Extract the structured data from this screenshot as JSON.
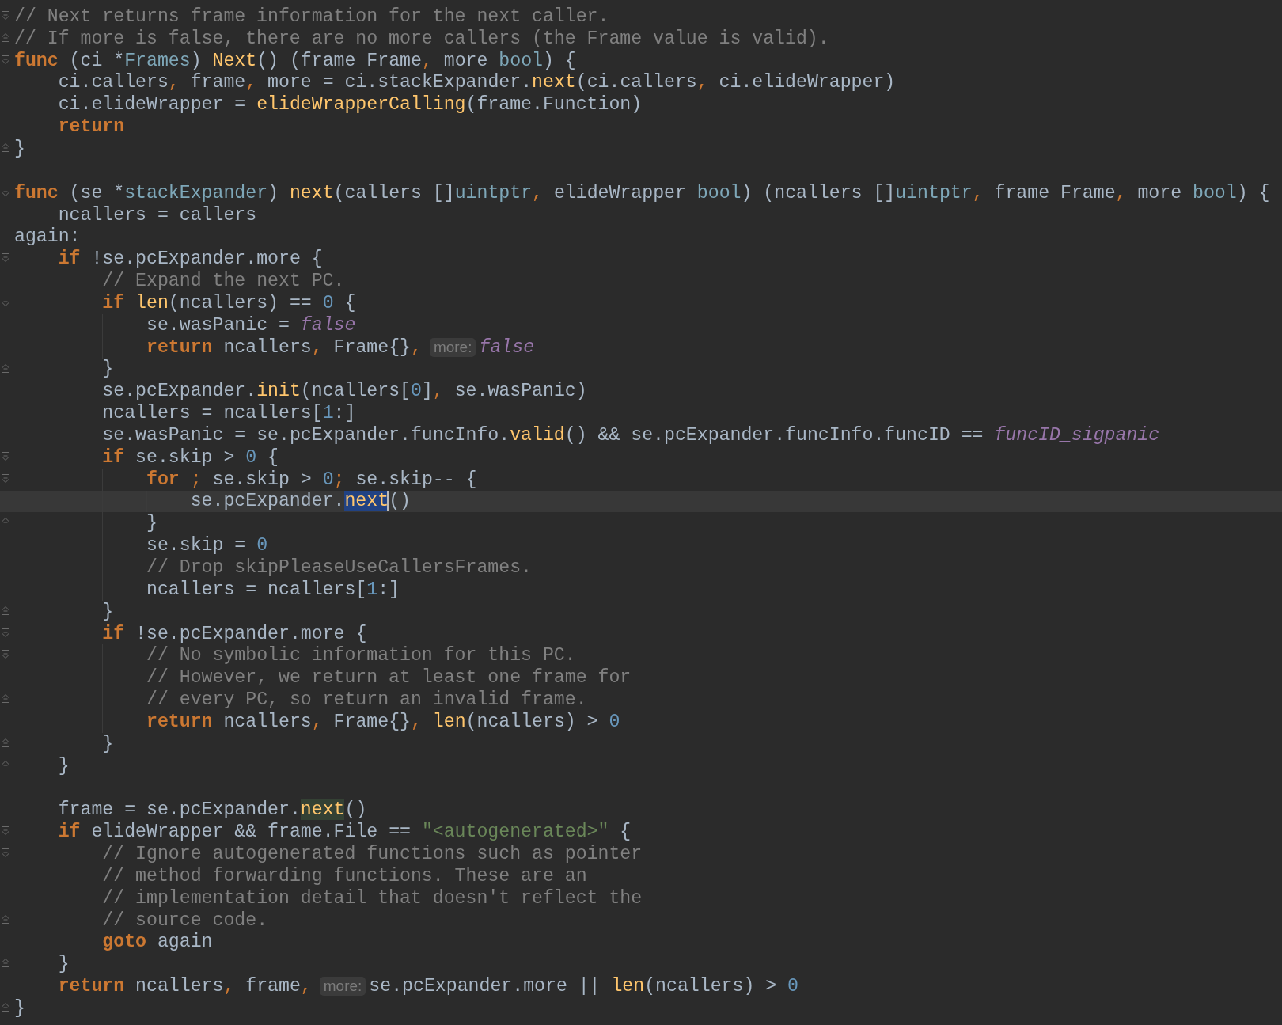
{
  "editor": {
    "lines": [
      {
        "fold_start": true,
        "fold_end": false,
        "current": false,
        "tokens": [
          {
            "text": "// Next returns frame information for the next caller.",
            "kind": "comment"
          }
        ]
      },
      {
        "fold_start": false,
        "fold_end": true,
        "current": false,
        "tokens": [
          {
            "text": "// If more is false, there are no more callers (the Frame value is valid).",
            "kind": "comment"
          }
        ]
      },
      {
        "fold_start": true,
        "fold_end": false,
        "current": false,
        "tokens": [
          {
            "text": "func",
            "kind": "keyword"
          },
          {
            "text": " (ci *",
            "kind": "plain"
          },
          {
            "text": "Frames",
            "kind": "type"
          },
          {
            "text": ") ",
            "kind": "plain"
          },
          {
            "text": "Next",
            "kind": "function"
          },
          {
            "text": "() (frame Frame",
            "kind": "plain"
          },
          {
            "text": ",",
            "kind": "punct"
          },
          {
            "text": " more ",
            "kind": "plain"
          },
          {
            "text": "bool",
            "kind": "type"
          },
          {
            "text": ") {",
            "kind": "plain"
          }
        ]
      },
      {
        "fold_start": false,
        "fold_end": false,
        "current": false,
        "tokens": [
          {
            "text": "    ci.callers",
            "kind": "plain"
          },
          {
            "text": ",",
            "kind": "punct"
          },
          {
            "text": " frame",
            "kind": "plain"
          },
          {
            "text": ",",
            "kind": "punct"
          },
          {
            "text": " more = ci.stackExpander.",
            "kind": "plain"
          },
          {
            "text": "next",
            "kind": "function"
          },
          {
            "text": "(ci.callers",
            "kind": "plain"
          },
          {
            "text": ",",
            "kind": "punct"
          },
          {
            "text": " ci.elideWrapper)",
            "kind": "plain"
          }
        ]
      },
      {
        "fold_start": false,
        "fold_end": false,
        "current": false,
        "tokens": [
          {
            "text": "    ci.elideWrapper = ",
            "kind": "plain"
          },
          {
            "text": "elideWrapperCalling",
            "kind": "function"
          },
          {
            "text": "(frame.Function)",
            "kind": "plain"
          }
        ]
      },
      {
        "fold_start": false,
        "fold_end": false,
        "current": false,
        "tokens": [
          {
            "text": "    return",
            "kind": "keyword"
          }
        ]
      },
      {
        "fold_start": false,
        "fold_end": true,
        "current": false,
        "tokens": [
          {
            "text": "}",
            "kind": "plain"
          }
        ]
      },
      {
        "fold_start": false,
        "fold_end": false,
        "current": false
      },
      {
        "fold_start": true,
        "fold_end": false,
        "current": false,
        "tokens": [
          {
            "text": "func",
            "kind": "keyword"
          },
          {
            "text": " (se *",
            "kind": "plain"
          },
          {
            "text": "stackExpander",
            "kind": "type"
          },
          {
            "text": ") ",
            "kind": "plain"
          },
          {
            "text": "next",
            "kind": "function"
          },
          {
            "text": "(callers []",
            "kind": "plain"
          },
          {
            "text": "uintptr",
            "kind": "type"
          },
          {
            "text": ",",
            "kind": "punct"
          },
          {
            "text": " elideWrapper ",
            "kind": "plain"
          },
          {
            "text": "bool",
            "kind": "type"
          },
          {
            "text": ") (ncallers []",
            "kind": "plain"
          },
          {
            "text": "uintptr",
            "kind": "type"
          },
          {
            "text": ",",
            "kind": "punct"
          },
          {
            "text": " frame Frame",
            "kind": "plain"
          },
          {
            "text": ",",
            "kind": "punct"
          },
          {
            "text": " more ",
            "kind": "plain"
          },
          {
            "text": "bool",
            "kind": "type"
          },
          {
            "text": ") {",
            "kind": "plain"
          }
        ]
      },
      {
        "fold_start": false,
        "fold_end": false,
        "current": false,
        "tokens": [
          {
            "text": "    ncallers = callers",
            "kind": "plain"
          }
        ]
      },
      {
        "fold_start": false,
        "fold_end": false,
        "current": false,
        "tokens": [
          {
            "text": "again:",
            "kind": "plain"
          }
        ]
      },
      {
        "fold_start": true,
        "fold_end": false,
        "current": false,
        "tokens": [
          {
            "text": "    if",
            "kind": "keyword"
          },
          {
            "text": " !se.pcExpander.more {",
            "kind": "plain"
          }
        ]
      },
      {
        "fold_start": false,
        "fold_end": false,
        "current": false,
        "tokens": [
          {
            "text": "        // Expand the next PC.",
            "kind": "comment"
          }
        ]
      },
      {
        "fold_start": true,
        "fold_end": false,
        "current": false,
        "tokens": [
          {
            "text": "        if ",
            "kind": "keyword"
          },
          {
            "text": "len",
            "kind": "function"
          },
          {
            "text": "(ncallers) == ",
            "kind": "plain"
          },
          {
            "text": "0",
            "kind": "number"
          },
          {
            "text": " {",
            "kind": "plain"
          }
        ]
      },
      {
        "fold_start": false,
        "fold_end": false,
        "current": false,
        "tokens": [
          {
            "text": "            se.wasPanic = ",
            "kind": "plain"
          },
          {
            "text": "false",
            "kind": "constant"
          }
        ]
      },
      {
        "fold_start": false,
        "fold_end": false,
        "current": false,
        "tokens": [
          {
            "text": "            return",
            "kind": "keyword"
          },
          {
            "text": " ncallers",
            "kind": "plain"
          },
          {
            "text": ",",
            "kind": "punct"
          },
          {
            "text": " Frame{}",
            "kind": "plain"
          },
          {
            "text": ",",
            "kind": "punct"
          },
          {
            "text": "more:",
            "kind": "hint"
          },
          {
            "text": "false",
            "kind": "constant"
          }
        ]
      },
      {
        "fold_start": false,
        "fold_end": true,
        "current": false,
        "tokens": [
          {
            "text": "        }",
            "kind": "plain"
          }
        ]
      },
      {
        "fold_start": false,
        "fold_end": false,
        "current": false,
        "tokens": [
          {
            "text": "        se.pcExpander.",
            "kind": "plain"
          },
          {
            "text": "init",
            "kind": "function"
          },
          {
            "text": "(ncallers[",
            "kind": "plain"
          },
          {
            "text": "0",
            "kind": "number"
          },
          {
            "text": "]",
            "kind": "plain"
          },
          {
            "text": ",",
            "kind": "punct"
          },
          {
            "text": " se.wasPanic)",
            "kind": "plain"
          }
        ]
      },
      {
        "fold_start": false,
        "fold_end": false,
        "current": false,
        "tokens": [
          {
            "text": "        ncallers = ncallers[",
            "kind": "plain"
          },
          {
            "text": "1",
            "kind": "number"
          },
          {
            "text": ":]",
            "kind": "plain"
          }
        ]
      },
      {
        "fold_start": false,
        "fold_end": false,
        "current": false,
        "tokens": [
          {
            "text": "        se.wasPanic = se.pcExpander.funcInfo.",
            "kind": "plain"
          },
          {
            "text": "valid",
            "kind": "function"
          },
          {
            "text": "() && se.pcExpander.funcInfo.funcID == ",
            "kind": "plain"
          },
          {
            "text": "funcID_sigpanic",
            "kind": "constant"
          }
        ]
      },
      {
        "fold_start": true,
        "fold_end": false,
        "current": false,
        "tokens": [
          {
            "text": "        if",
            "kind": "keyword"
          },
          {
            "text": " se.skip > ",
            "kind": "plain"
          },
          {
            "text": "0",
            "kind": "number"
          },
          {
            "text": " {",
            "kind": "plain"
          }
        ]
      },
      {
        "fold_start": true,
        "fold_end": false,
        "current": false,
        "tokens": [
          {
            "text": "            for",
            "kind": "keyword"
          },
          {
            "text": " ;",
            "kind": "punct"
          },
          {
            "text": " se.skip > ",
            "kind": "plain"
          },
          {
            "text": "0",
            "kind": "number"
          },
          {
            "text": ";",
            "kind": "punct"
          },
          {
            "text": " se.skip-- {",
            "kind": "plain"
          }
        ]
      },
      {
        "fold_start": false,
        "fold_end": false,
        "current": true,
        "tokens": [
          {
            "text": "                se.pcExpander.",
            "kind": "plain"
          },
          {
            "text": "next",
            "kind": "selection"
          },
          {
            "text": "()",
            "kind": "plain"
          }
        ]
      },
      {
        "fold_start": false,
        "fold_end": true,
        "current": false,
        "tokens": [
          {
            "text": "            }",
            "kind": "plain"
          }
        ]
      },
      {
        "fold_start": false,
        "fold_end": false,
        "current": false,
        "tokens": [
          {
            "text": "            se.skip = ",
            "kind": "plain"
          },
          {
            "text": "0",
            "kind": "number"
          }
        ]
      },
      {
        "fold_start": false,
        "fold_end": false,
        "current": false,
        "tokens": [
          {
            "text": "            // Drop skipPleaseUseCallersFrames.",
            "kind": "comment"
          }
        ]
      },
      {
        "fold_start": false,
        "fold_end": false,
        "current": false,
        "tokens": [
          {
            "text": "            ncallers = ncallers[",
            "kind": "plain"
          },
          {
            "text": "1",
            "kind": "number"
          },
          {
            "text": ":]",
            "kind": "plain"
          }
        ]
      },
      {
        "fold_start": false,
        "fold_end": true,
        "current": false,
        "tokens": [
          {
            "text": "        }",
            "kind": "plain"
          }
        ]
      },
      {
        "fold_start": true,
        "fold_end": false,
        "current": false,
        "tokens": [
          {
            "text": "        if",
            "kind": "keyword"
          },
          {
            "text": " !se.pcExpander.more {",
            "kind": "plain"
          }
        ]
      },
      {
        "fold_start": true,
        "fold_end": false,
        "current": false,
        "tokens": [
          {
            "text": "            // No symbolic information for this PC.",
            "kind": "comment"
          }
        ]
      },
      {
        "fold_start": false,
        "fold_end": false,
        "current": false,
        "tokens": [
          {
            "text": "            // However, we return at least one frame for",
            "kind": "comment"
          }
        ]
      },
      {
        "fold_start": false,
        "fold_end": true,
        "current": false,
        "tokens": [
          {
            "text": "            // every PC, so return an invalid frame.",
            "kind": "comment"
          }
        ]
      },
      {
        "fold_start": false,
        "fold_end": false,
        "current": false,
        "tokens": [
          {
            "text": "            return",
            "kind": "keyword"
          },
          {
            "text": " ncallers",
            "kind": "plain"
          },
          {
            "text": ",",
            "kind": "punct"
          },
          {
            "text": " Frame{}",
            "kind": "plain"
          },
          {
            "text": ", ",
            "kind": "punct"
          },
          {
            "text": "len",
            "kind": "function"
          },
          {
            "text": "(ncallers) > ",
            "kind": "plain"
          },
          {
            "text": "0",
            "kind": "number"
          }
        ]
      },
      {
        "fold_start": false,
        "fold_end": true,
        "current": false,
        "tokens": [
          {
            "text": "        }",
            "kind": "plain"
          }
        ]
      },
      {
        "fold_start": false,
        "fold_end": true,
        "current": false,
        "tokens": [
          {
            "text": "    }",
            "kind": "plain"
          }
        ]
      },
      {
        "fold_start": false,
        "fold_end": false,
        "current": false
      },
      {
        "fold_start": false,
        "fold_end": false,
        "current": false,
        "tokens": [
          {
            "text": "    frame = se.pcExpander.",
            "kind": "plain"
          },
          {
            "text": "next",
            "kind": "usage"
          },
          {
            "text": "()",
            "kind": "plain"
          }
        ]
      },
      {
        "fold_start": true,
        "fold_end": false,
        "current": false,
        "tokens": [
          {
            "text": "    if",
            "kind": "keyword"
          },
          {
            "text": " elideWrapper && frame.File == ",
            "kind": "plain"
          },
          {
            "text": "\"<autogenerated>\"",
            "kind": "string"
          },
          {
            "text": " {",
            "kind": "plain"
          }
        ]
      },
      {
        "fold_start": true,
        "fold_end": false,
        "current": false,
        "tokens": [
          {
            "text": "        // Ignore autogenerated functions such as pointer",
            "kind": "comment"
          }
        ]
      },
      {
        "fold_start": false,
        "fold_end": false,
        "current": false,
        "tokens": [
          {
            "text": "        // method forwarding functions. These are an",
            "kind": "comment"
          }
        ]
      },
      {
        "fold_start": false,
        "fold_end": false,
        "current": false,
        "tokens": [
          {
            "text": "        // implementation detail that doesn't reflect the",
            "kind": "comment"
          }
        ]
      },
      {
        "fold_start": false,
        "fold_end": true,
        "current": false,
        "tokens": [
          {
            "text": "        // source code.",
            "kind": "comment"
          }
        ]
      },
      {
        "fold_start": false,
        "fold_end": false,
        "current": false,
        "tokens": [
          {
            "text": "        goto",
            "kind": "keyword"
          },
          {
            "text": " again",
            "kind": "plain"
          }
        ]
      },
      {
        "fold_start": false,
        "fold_end": true,
        "current": false,
        "tokens": [
          {
            "text": "    }",
            "kind": "plain"
          }
        ]
      },
      {
        "fold_start": false,
        "fold_end": false,
        "current": false,
        "tokens": [
          {
            "text": "    return",
            "kind": "keyword"
          },
          {
            "text": " ncallers",
            "kind": "plain"
          },
          {
            "text": ",",
            "kind": "punct"
          },
          {
            "text": " frame",
            "kind": "plain"
          },
          {
            "text": ",",
            "kind": "punct"
          },
          {
            "text": "more:",
            "kind": "hint"
          },
          {
            "text": "se.pcExpander.more || ",
            "kind": "plain"
          },
          {
            "text": "len",
            "kind": "function"
          },
          {
            "text": "(ncallers) > ",
            "kind": "plain"
          },
          {
            "text": "0",
            "kind": "number"
          }
        ]
      },
      {
        "fold_start": false,
        "fold_end": true,
        "current": false,
        "tokens": [
          {
            "text": "}",
            "kind": "plain"
          }
        ]
      }
    ]
  }
}
